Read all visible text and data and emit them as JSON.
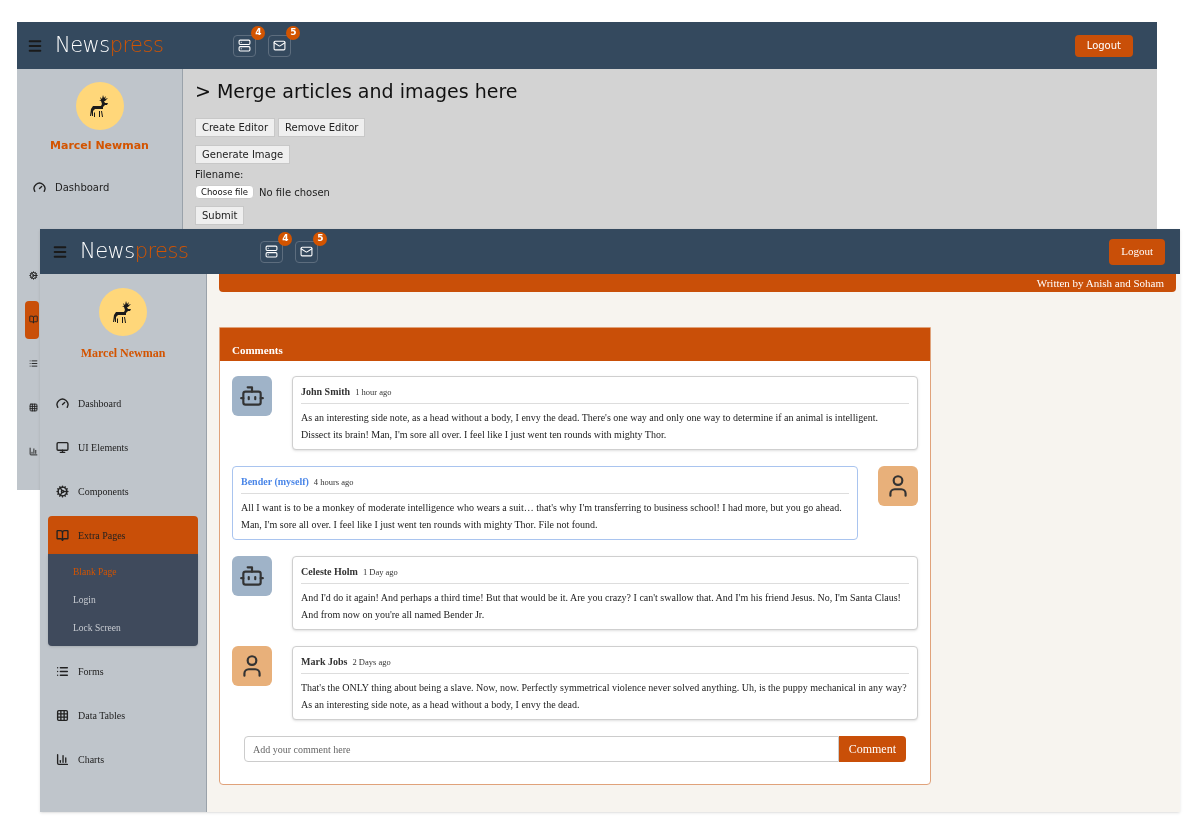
{
  "back_window": {
    "header": {
      "logo_part_1": "News",
      "logo_part_2": "press",
      "badges": [
        "4",
        "5"
      ],
      "logout": "Logout"
    },
    "sidebar": {
      "user_name": "Marcel Newman",
      "items": [
        {
          "label": "Dashboard",
          "selected": false
        },
        {
          "selected": false
        },
        {
          "selected": true
        },
        {
          "selected": false
        },
        {
          "selected": false
        },
        {
          "selected": false
        }
      ]
    },
    "content": {
      "heading": "> Merge articles and images here",
      "editor_buttons": [
        "Create Editor",
        "Remove Editor"
      ],
      "generate_button": "Generate Image",
      "filename_label": "Filename:",
      "file_button": "Choose file",
      "file_status": "No file chosen",
      "submit_button": "Submit"
    }
  },
  "front_window": {
    "header": {
      "logo_part_1": "News",
      "logo_part_2": "press",
      "badges": [
        "4",
        "5"
      ],
      "logout": "Logout"
    },
    "sidebar": {
      "user_name": "Marcel Newman",
      "items": [
        {
          "label": "Dashboard",
          "selected": false
        },
        {
          "label": "UI Elements",
          "selected": false
        },
        {
          "label": "Components",
          "selected": false
        },
        {
          "label": "Extra Pages",
          "selected": true,
          "expanded": true,
          "children": [
            {
              "label": "Blank Page",
              "selected": true
            },
            {
              "label": "Login",
              "selected": false
            },
            {
              "label": "Lock Screen",
              "selected": false
            }
          ]
        },
        {
          "label": "Forms",
          "selected": false
        },
        {
          "label": "Data Tables",
          "selected": false
        },
        {
          "label": "Charts",
          "selected": false
        }
      ]
    },
    "article_footer": "Written by Anish and Soham",
    "comments": {
      "title": "Comments",
      "items": [
        {
          "author": "John Smith",
          "time": "1 hour ago",
          "own": false,
          "kind": "robot",
          "text": "As an interesting side note, as a head without a body, I envy the dead. There's one way and only one way to determine if an animal is intelligent. Dissect its brain! Man, I'm sore all over. I feel like I just went ten rounds with mighty Thor."
        },
        {
          "author": "Bender (myself)",
          "time": "4 hours ago",
          "own": true,
          "kind": "person",
          "text": "All I want is to be a monkey of moderate intelligence who wears a suit… that's why I'm transferring to business school! I had more, but you go ahead. Man, I'm sore all over. I feel like I just went ten rounds with mighty Thor. File not found."
        },
        {
          "author": "Celeste Holm",
          "time": "1 Day ago",
          "own": false,
          "kind": "robot",
          "text": "And I'd do it again! And perhaps a third time! But that would be it. Are you crazy? I can't swallow that. And I'm his friend Jesus. No, I'm Santa Claus! And from now on you're all named Bender Jr."
        },
        {
          "author": "Mark Jobs",
          "time": "2 Days ago",
          "own": false,
          "kind": "person",
          "text": "That's the ONLY thing about being a slave. Now, now. Perfectly symmetrical violence never solved anything. Uh, is the puppy mechanical in any way? As an interesting side note, as a head without a body, I envy the dead."
        }
      ],
      "input_placeholder": "Add your comment here",
      "submit": "Comment"
    }
  }
}
